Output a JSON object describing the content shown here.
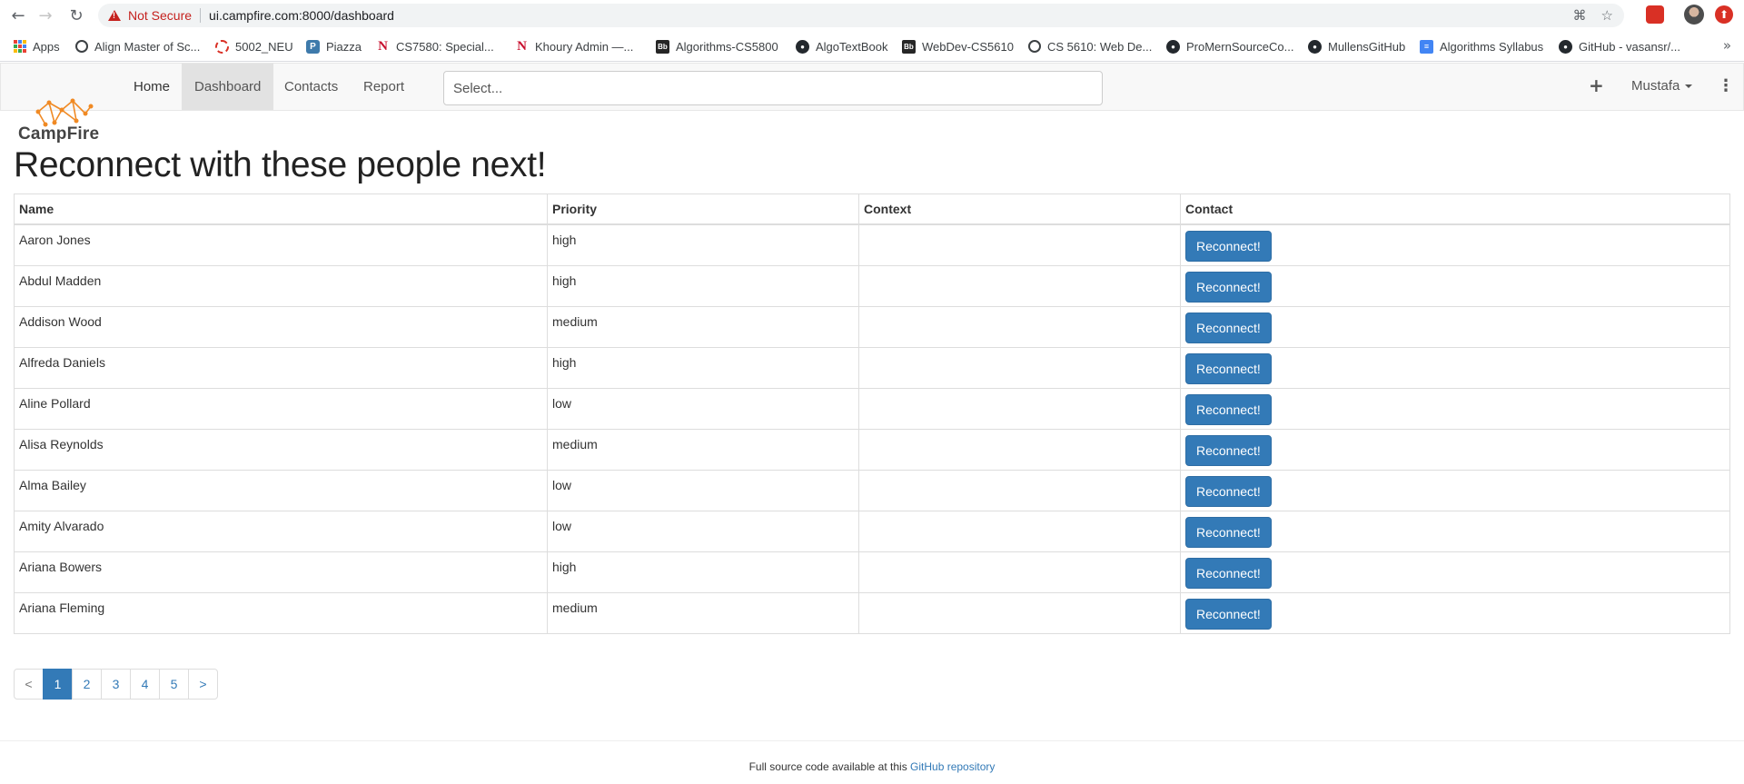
{
  "browser": {
    "security_status": "Not Secure",
    "url": "ui.campfire.com:8000/dashboard",
    "bookmarks": [
      {
        "label": "Apps",
        "icon": "apps-grid-icon"
      },
      {
        "label": "Align Master of Sc...",
        "icon": "globe-icon"
      },
      {
        "label": "5002_NEU",
        "icon": "ring-icon"
      },
      {
        "label": "Piazza",
        "icon": "piazza-icon"
      },
      {
        "label": "CS7580: Special...",
        "icon": "northeastern-icon"
      },
      {
        "label": "Khoury Admin —...",
        "icon": "northeastern-icon"
      },
      {
        "label": "Algorithms-CS5800",
        "icon": "blackboard-icon"
      },
      {
        "label": "AlgoTextBook",
        "icon": "github-icon"
      },
      {
        "label": "WebDev-CS5610",
        "icon": "blackboard-icon"
      },
      {
        "label": "CS 5610: Web De...",
        "icon": "globe-icon"
      },
      {
        "label": "ProMernSourceCo...",
        "icon": "github-icon"
      },
      {
        "label": "MullensGitHub",
        "icon": "github-icon"
      },
      {
        "label": "Algorithms Syllabus",
        "icon": "docs-icon"
      },
      {
        "label": "GitHub - vasansr/...",
        "icon": "github-icon"
      }
    ],
    "bookmarks_overflow": "»"
  },
  "navbar": {
    "items": [
      {
        "label": "Home"
      },
      {
        "label": "Dashboard",
        "active": true
      },
      {
        "label": "Contacts"
      },
      {
        "label": "Report"
      }
    ],
    "search_placeholder": "Select...",
    "add_icon": "plus-icon",
    "user_name": "Mustafa",
    "menu_icon": "kebab-icon"
  },
  "logo": {
    "text": "CampFire"
  },
  "page": {
    "title": "Reconnect with these people next!"
  },
  "table": {
    "columns": [
      "Name",
      "Priority",
      "Context",
      "Contact"
    ],
    "rows": [
      {
        "name": "Aaron Jones",
        "priority": "high",
        "context": "",
        "action": "Reconnect!"
      },
      {
        "name": "Abdul Madden",
        "priority": "high",
        "context": "",
        "action": "Reconnect!"
      },
      {
        "name": "Addison Wood",
        "priority": "medium",
        "context": "",
        "action": "Reconnect!"
      },
      {
        "name": "Alfreda Daniels",
        "priority": "high",
        "context": "",
        "action": "Reconnect!"
      },
      {
        "name": "Aline Pollard",
        "priority": "low",
        "context": "",
        "action": "Reconnect!"
      },
      {
        "name": "Alisa Reynolds",
        "priority": "medium",
        "context": "",
        "action": "Reconnect!"
      },
      {
        "name": "Alma Bailey",
        "priority": "low",
        "context": "",
        "action": "Reconnect!"
      },
      {
        "name": "Amity Alvarado",
        "priority": "low",
        "context": "",
        "action": "Reconnect!"
      },
      {
        "name": "Ariana Bowers",
        "priority": "high",
        "context": "",
        "action": "Reconnect!"
      },
      {
        "name": "Ariana Fleming",
        "priority": "medium",
        "context": "",
        "action": "Reconnect!"
      }
    ]
  },
  "pagination": {
    "prev": "<",
    "pages": [
      "1",
      "2",
      "3",
      "4",
      "5"
    ],
    "current": "1",
    "next": ">"
  },
  "footer": {
    "text": "Full source code available at this",
    "link": "GitHub repository"
  },
  "colors": {
    "primary": "#337ab7",
    "warning": "#c5221f",
    "logo": "#f08a24"
  }
}
